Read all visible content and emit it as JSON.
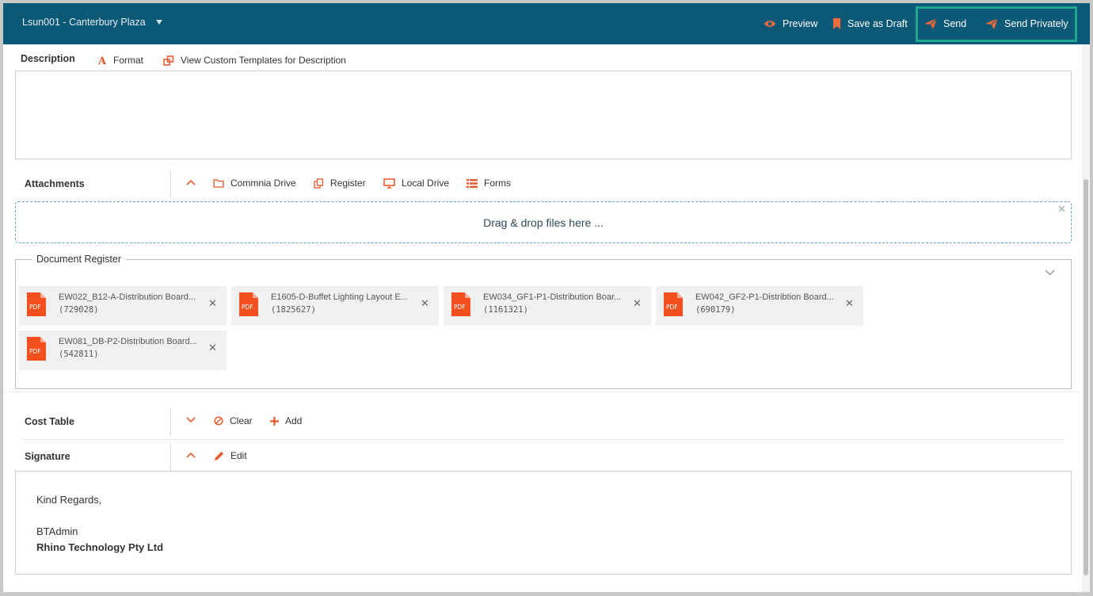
{
  "header": {
    "project": "Lsun001 - Canterbury Plaza",
    "preview": "Preview",
    "save_draft": "Save as Draft",
    "send": "Send",
    "send_privately": "Send Privately"
  },
  "description": {
    "title": "Description",
    "format": "Format",
    "templates": "View Custom Templates for Description"
  },
  "attachments": {
    "title": "Attachments",
    "sources": [
      "Commnia Drive",
      "Register",
      "Local Drive",
      "Forms"
    ],
    "dropzone": "Drag & drop files here ..."
  },
  "document_register": {
    "title": "Document Register",
    "files": [
      {
        "name": "EW022_B12-A-Distribution Board...",
        "id": "(729028)",
        "badge": "PDF"
      },
      {
        "name": "E1605-D-Buffet Lighting Layout E...",
        "id": "(1825627)",
        "badge": "PDF"
      },
      {
        "name": "EW034_GF1-P1-Distribution Boar...",
        "id": "(1161321)",
        "badge": "PDF"
      },
      {
        "name": "EW042_GF2-P1-Distribtion Board...",
        "id": "(690179)",
        "badge": "PDF"
      },
      {
        "name": "EW081_DB-P2-Distribution Board...",
        "id": "(542811)",
        "badge": "PDF"
      }
    ]
  },
  "cost_table": {
    "title": "Cost Table",
    "clear": "Clear",
    "add": "Add"
  },
  "signature": {
    "title": "Signature",
    "edit": "Edit",
    "regards": "Kind Regards,",
    "name": "BTAdmin",
    "company": "Rhino Technology Pty Ltd"
  },
  "colors": {
    "header_bg": "#0b5877",
    "accent": "#e8562a",
    "highlight": "#1fa78f"
  }
}
